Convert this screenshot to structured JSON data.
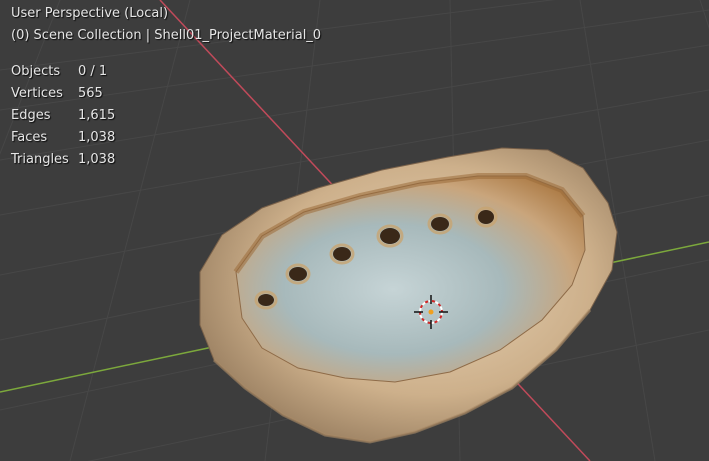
{
  "viewport": {
    "view_title": "User Perspective (Local)",
    "collection_info": "(0) Scene Collection | Shell01_ProjectMaterial_0"
  },
  "stats": [
    {
      "label": "Objects",
      "value": "0 / 1"
    },
    {
      "label": "Vertices",
      "value": "565"
    },
    {
      "label": "Edges",
      "value": "1,615"
    },
    {
      "label": "Faces",
      "value": "1,038"
    },
    {
      "label": "Triangles",
      "value": "1,038"
    }
  ],
  "colors": {
    "background": "#3d3d3d",
    "grid_line": "#474747",
    "x_axis": "#c04a5a",
    "y_axis": "#7ca83c",
    "text": "#e6e6e6"
  },
  "icons": {
    "cursor": "3d-cursor-icon"
  }
}
